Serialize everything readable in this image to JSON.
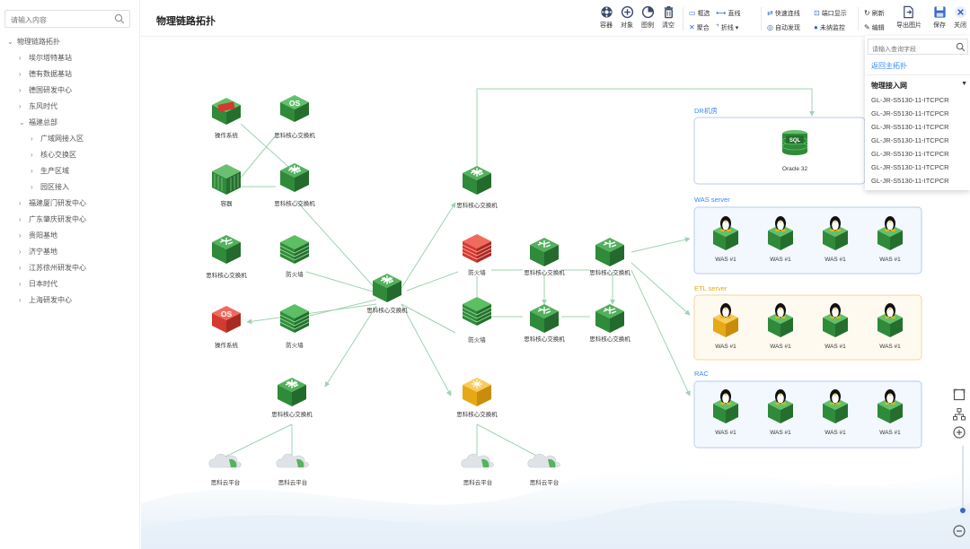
{
  "sidebar": {
    "search_placeholder": "请输入内容",
    "tree": [
      {
        "label": "物理链路拓扑",
        "expanded": true,
        "level": 0
      },
      {
        "label": "埃尔塔特基站",
        "expanded": false,
        "level": 1
      },
      {
        "label": "德有数据基站",
        "expanded": false,
        "level": 1
      },
      {
        "label": "德国研发中心",
        "expanded": false,
        "level": 1
      },
      {
        "label": "东风时代",
        "expanded": false,
        "level": 1
      },
      {
        "label": "福建总部",
        "expanded": true,
        "level": 1
      },
      {
        "label": "广域网接入区",
        "expanded": false,
        "level": 2
      },
      {
        "label": "核心交换区",
        "expanded": false,
        "level": 2
      },
      {
        "label": "生产区域",
        "expanded": false,
        "level": 2
      },
      {
        "label": "园区接入",
        "expanded": false,
        "level": 2
      },
      {
        "label": "福建厦门研发中心",
        "expanded": false,
        "level": 1
      },
      {
        "label": "广东肇庆研发中心",
        "expanded": false,
        "level": 1
      },
      {
        "label": "贵阳基地",
        "expanded": false,
        "level": 1
      },
      {
        "label": "济宁基地",
        "expanded": false,
        "level": 1
      },
      {
        "label": "江苏徐州研发中心",
        "expanded": false,
        "level": 1
      },
      {
        "label": "日本时代",
        "expanded": false,
        "level": 1
      },
      {
        "label": "上海研发中心",
        "expanded": false,
        "level": 1
      }
    ]
  },
  "header": {
    "title": "物理链路拓扑"
  },
  "toolbar": {
    "big_buttons": [
      {
        "label": "容器",
        "icon": "container-icon"
      },
      {
        "label": "对象",
        "icon": "add-object-icon"
      },
      {
        "label": "图例",
        "icon": "legend-icon"
      },
      {
        "label": "清空",
        "icon": "trash-icon"
      }
    ],
    "row1": [
      {
        "label": "框选",
        "icon": "box-select-icon"
      },
      {
        "label": "直线",
        "icon": "line-icon"
      },
      {
        "label": "快速连线",
        "icon": "quick-connect-icon"
      },
      {
        "label": "端口显示",
        "icon": "port-icon"
      }
    ],
    "row2": [
      {
        "label": "聚合",
        "icon": "aggregate-icon"
      },
      {
        "label": "折线",
        "icon": "polyline-icon"
      },
      {
        "label": "自动发现",
        "icon": "auto-discover-icon"
      },
      {
        "label": "未纳监控",
        "icon": "unmonitored-icon"
      }
    ],
    "refresh_label": "刷新",
    "edit_label": "编辑",
    "export_label": "导出图片",
    "save_label": "保存",
    "close_label": "关闭"
  },
  "dropdown": {
    "search_placeholder": "请输入查询字段",
    "back_link": "返回主拓扑",
    "group_label": "物理接入网",
    "options": [
      "GL-JR-S5130-11-ITCPCR",
      "GL-JR-S5130-11-ITCPCR",
      "GL-JR-S5130-11-ITCPCR",
      "GL-JR-S5130-11-ITCPCR",
      "GL-JR-S5130-11-ITCPCR",
      "GL-JR-S5130-11-ITCPCR",
      "GL-JR-S5130-11-ITCPCR"
    ]
  },
  "topology": {
    "nodes": {
      "os_top": "操作系统",
      "sw_top": "思科核心交换机",
      "container": "容器",
      "sw_left2": "思科核心交换机",
      "sw_left3": "思科核心交换机",
      "fw_left": "防火墙",
      "os_red": "操作系统",
      "fw_left2": "防火墙",
      "sw_center": "思科核心交换机",
      "sw_mid_top": "思科核心交换机",
      "fw_red": "防火墙",
      "fw_mid2": "防火墙",
      "sw_m1": "思科核心交换机",
      "sw_m2": "思科核心交换机",
      "sw_m3": "思科核心交换机",
      "sw_m4": "思科核心交换机",
      "sw_bottom_left": "思科核心交换机",
      "sw_bottom_mid": "思科核心交换机",
      "cloud1": "思科云平台",
      "cloud2": "思科云平台",
      "cloud3": "思科云平台",
      "cloud4": "思科云平台"
    },
    "groups": {
      "dr": {
        "title": "DR机房",
        "db_label": "Oracle 32",
        "sql": "SQL"
      },
      "was": {
        "title": "WAS server",
        "item": "WAS #1"
      },
      "etl": {
        "title": "ETL server",
        "item": "WAS #1"
      },
      "rac": {
        "title": "RAC",
        "item": "WAS #1"
      }
    },
    "os_text": "OS"
  },
  "colors": {
    "accent": "#3a67c8",
    "switch_green": "#2f8a3a",
    "firewall_red": "#d43a2f",
    "edge": "#9fd3b0",
    "group_border": "#b8cdea",
    "group_fill": "#f3f8fe",
    "etl_border": "#f1d6a0",
    "etl_fill": "#fffaf0"
  }
}
